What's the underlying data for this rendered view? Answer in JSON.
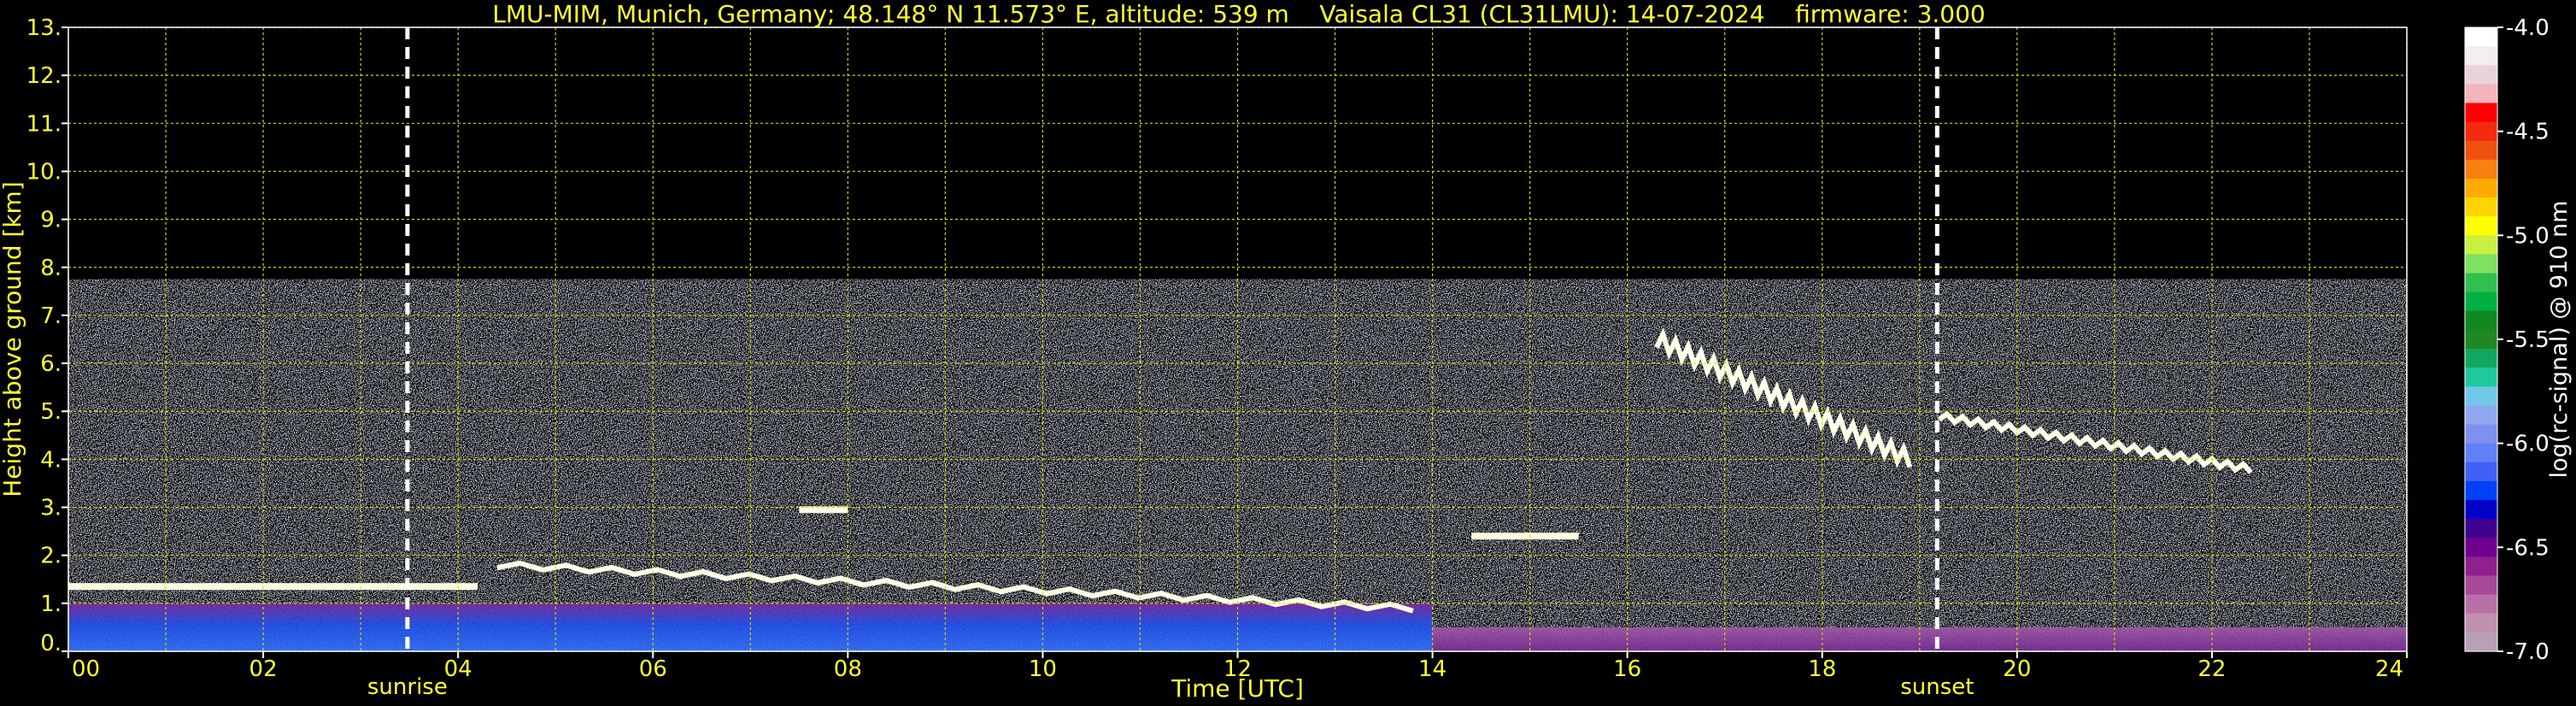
{
  "chart_data": {
    "type": "heatmap",
    "title": "LMU-MIM, Munich, Germany; 48.148° N 11.573° E, altitude: 539 m    Vaisala CL31 (CL31LMU): 14-07-2024    firmware: 3.000",
    "xlabel": "Time [UTC]",
    "ylabel": "Height above ground [km]",
    "xlim": [
      0,
      24
    ],
    "ylim": [
      0,
      13
    ],
    "x_ticks": [
      "00",
      "02",
      "04",
      "06",
      "08",
      "10",
      "12",
      "14",
      "16",
      "18",
      "20",
      "22",
      "24"
    ],
    "y_ticks": [
      "0.",
      "1.",
      "2.",
      "3.",
      "4.",
      "5.",
      "6.",
      "7.",
      "8.",
      "9.",
      "10.",
      "11.",
      "12.",
      "13."
    ],
    "grid": true,
    "noise_top_km": 7.75,
    "markers": [
      {
        "label": "sunrise",
        "time": 3.48
      },
      {
        "label": "sunset",
        "time": 19.18
      }
    ],
    "colorbar": {
      "label": "log(rc-signal) @ 910 nm",
      "range": [
        -7.0,
        -4.0
      ],
      "ticks": [
        "-4.0",
        "-4.5",
        "-5.0",
        "-5.5",
        "-6.0",
        "-6.5",
        "-7.0"
      ],
      "colors": [
        "#ffffff",
        "#f2eef2",
        "#e8d4d8",
        "#f4b4bc",
        "#ff0000",
        "#f42a10",
        "#f05010",
        "#f88010",
        "#ffaa00",
        "#ffd400",
        "#ffff00",
        "#c8f040",
        "#80e060",
        "#30c050",
        "#00b040",
        "#108820",
        "#208820",
        "#10a860",
        "#20c8a0",
        "#70c8e8",
        "#90a8f0",
        "#8090f0",
        "#6080f8",
        "#4060f8",
        "#0040f8",
        "#0000c8",
        "#400090",
        "#700090",
        "#902090",
        "#a84898",
        "#b870a8",
        "#c090b0",
        "#b8a0b8"
      ]
    },
    "layers": [
      {
        "type": "boundary layer aerosol",
        "time_range": [
          0,
          14
        ],
        "top_km_range": [
          0.3,
          1.0
        ]
      },
      {
        "type": "boundary layer aerosol",
        "time_range": [
          14,
          24
        ],
        "top_km_range": [
          0.3,
          0.5
        ]
      },
      {
        "type": "cloud",
        "time_range": [
          0,
          4.2
        ],
        "height_km": 1.35
      },
      {
        "type": "cloud",
        "time_range": [
          4.4,
          13.8
        ],
        "height_km_range": [
          0.9,
          1.8
        ]
      },
      {
        "type": "cloud",
        "time_range": [
          7.5,
          8.0
        ],
        "height_km": 2.95
      },
      {
        "type": "cloud",
        "time_range": [
          14.4,
          15.5
        ],
        "height_km": 2.4
      },
      {
        "type": "cloud",
        "time_range": [
          16.3,
          18.9
        ],
        "height_km_range": [
          4.0,
          6.5
        ]
      },
      {
        "type": "cloud",
        "time_range": [
          19.2,
          22.4
        ],
        "height_km_range": [
          3.8,
          4.9
        ]
      }
    ]
  }
}
